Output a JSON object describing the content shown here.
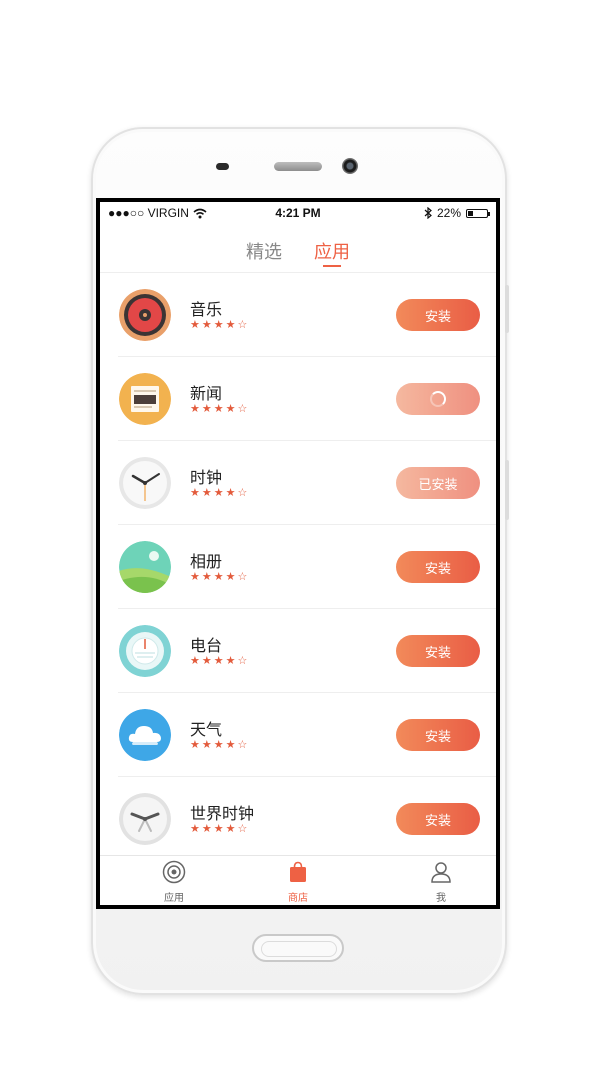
{
  "status_bar": {
    "carrier": "●●●○○ VIRGIN",
    "time": "4:21 PM",
    "battery_percent": "22%"
  },
  "top_tabs": [
    {
      "label": "精选"
    },
    {
      "label": "应用"
    }
  ],
  "apps": [
    {
      "name": "音乐",
      "rating": "★★★★☆",
      "button": "安装"
    },
    {
      "name": "新闻",
      "rating": "★★★★☆",
      "button": ""
    },
    {
      "name": "时钟",
      "rating": "★★★★☆",
      "button": "已安装"
    },
    {
      "name": "相册",
      "rating": "★★★★☆",
      "button": "安装"
    },
    {
      "name": "电台",
      "rating": "★★★★☆",
      "button": "安装"
    },
    {
      "name": "天气",
      "rating": "★★★★☆",
      "button": "安装"
    },
    {
      "name": "世界时钟",
      "rating": "★★★★☆",
      "button": "安装"
    }
  ],
  "bottom_tabs": [
    {
      "label": "应用"
    },
    {
      "label": "商店"
    },
    {
      "label": "我"
    }
  ],
  "colors": {
    "accent": "#ee6144",
    "button_start": "#f28a5a",
    "button_end": "#e95d45"
  }
}
